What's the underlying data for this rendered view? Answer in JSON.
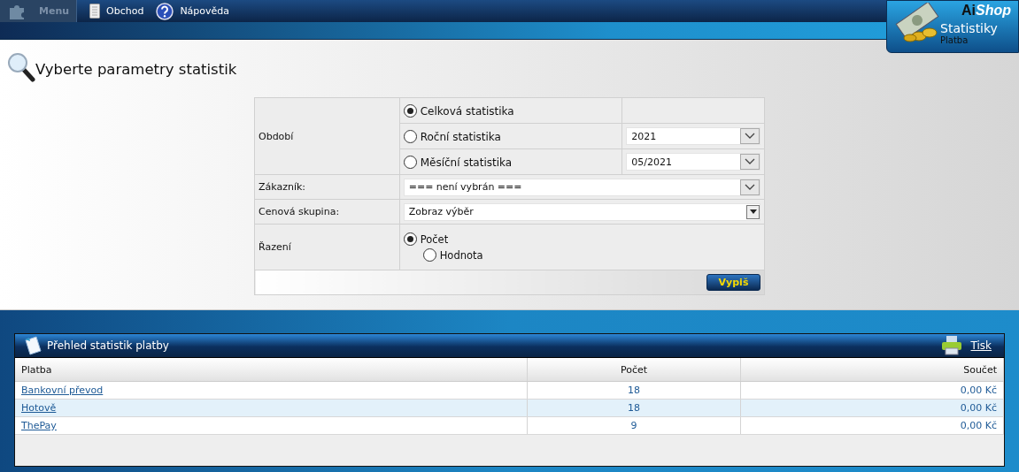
{
  "menu": {
    "label": "Menu",
    "disabled": true
  },
  "nav": [
    {
      "label": "Obchod",
      "kind": "doc"
    },
    {
      "label": "Nápověda",
      "kind": "help"
    }
  ],
  "badge": {
    "brand_plain": "Ai",
    "brand_italic": "Shop",
    "title": "Statistiky",
    "subtitle": "Platba"
  },
  "heading": "Vyberte parametry statistik",
  "form": {
    "period_label": "Období",
    "periods": [
      {
        "label": "Celková statistika",
        "selected": true
      },
      {
        "label": "Roční statistika",
        "selected": false,
        "select_value": "2021"
      },
      {
        "label": "Měsíční statistika",
        "selected": false,
        "select_value": "05/2021"
      }
    ],
    "customer_label": "Zákazník:",
    "customer_value": "=== není vybrán ===",
    "price_group_label": "Cenová skupina:",
    "price_group_value": "Zobraz výběr",
    "sort_label": "Řazení",
    "sorts": [
      {
        "label": "Počet",
        "selected": true
      },
      {
        "label": "Hodnota",
        "selected": false
      }
    ],
    "submit": "Vypiš"
  },
  "panel": {
    "title": "Přehled statistik platby",
    "print": "Tisk",
    "columns": [
      "Platba",
      "Počet",
      "Součet"
    ],
    "rows": [
      {
        "name": "Bankovní převod",
        "count": "18",
        "sum": "0,00 Kč"
      },
      {
        "name": "Hotově",
        "count": "18",
        "sum": "0,00 Kč"
      },
      {
        "name": "ThePay",
        "count": "9",
        "sum": "0,00 Kč"
      }
    ]
  }
}
